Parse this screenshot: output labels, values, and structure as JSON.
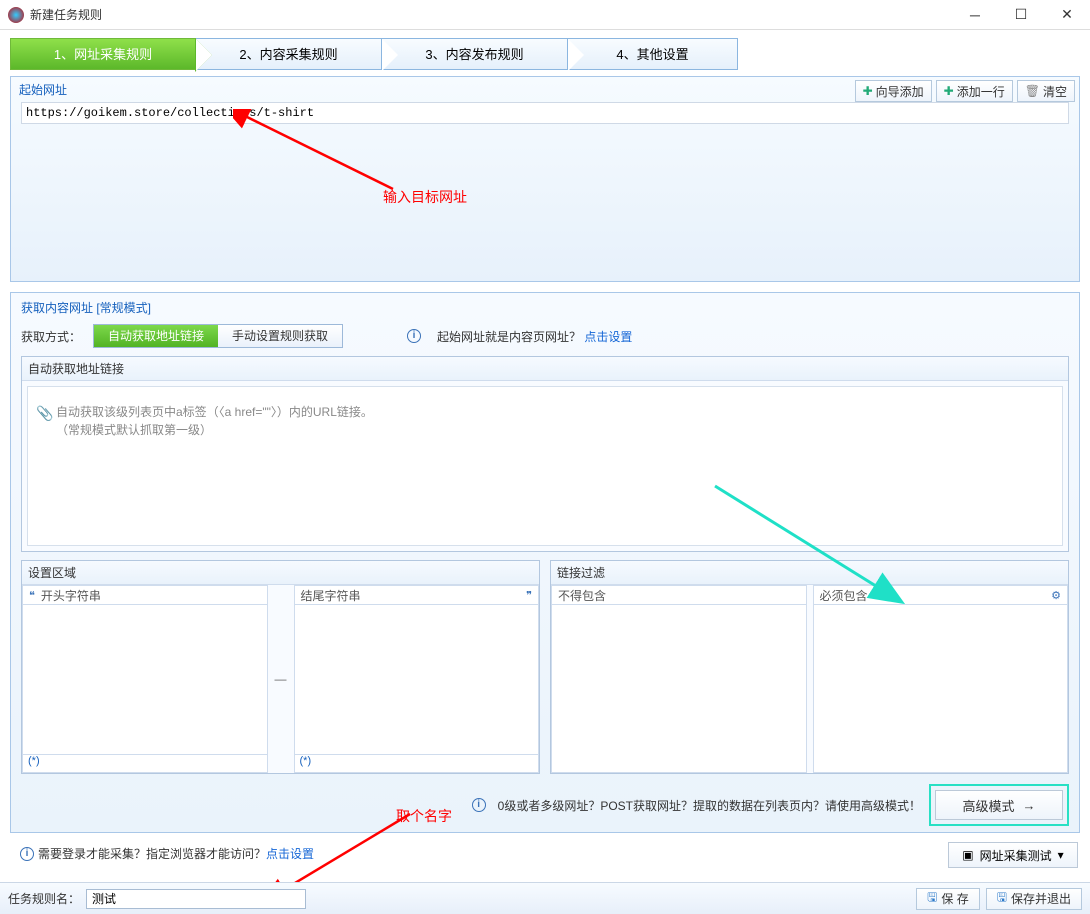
{
  "titlebar": {
    "title": "新建任务规则"
  },
  "steps": {
    "s1": "1、网址采集规则",
    "s2": "2、内容采集规则",
    "s3": "3、内容发布规则",
    "s4": "4、其他设置"
  },
  "start_url_section": {
    "title": "起始网址",
    "btn_wizard_add": "向导添加",
    "btn_add_row": "添加一行",
    "btn_clear": "清空",
    "url_value": "https://goikem.store/collections/t-shirt",
    "annotation": "输入目标网址"
  },
  "content_section": {
    "title": "获取内容网址 [常规模式]",
    "mode_label": "获取方式：",
    "mode_auto": "自动获取地址链接",
    "mode_manual": "手动设置规则获取",
    "hint_text": "起始网址就是内容页网址？",
    "hint_link": "点击设置",
    "auto_group_title": "自动获取地址链接",
    "auto_desc_line1": "自动获取该级列表页中a标签（〈a href=\"\"〉）内的URL链接。",
    "auto_desc_line2": "（常规模式默认抓取第一级）"
  },
  "area_section": {
    "title": "设置区域",
    "col1_head": "开头字符串",
    "col2_head": "结尾字符串",
    "star_mark": "(*)"
  },
  "filter_section": {
    "title": "链接过滤",
    "col1_head": "不得包含",
    "col2_head": "必须包含"
  },
  "advanced": {
    "hint": "0级或者多级网址？POST获取网址？提取的数据在列表页内？请使用高级模式！",
    "btn": "高级模式"
  },
  "annotation2": "取个名字",
  "login_hint": {
    "text": "需要登录才能采集？指定浏览器才能访问？",
    "link": "点击设置"
  },
  "test_btn": "网址采集测试",
  "footer": {
    "label": "任务规则名：",
    "value": "测试",
    "btn_save": "保 存",
    "btn_save_exit": "保存并退出"
  }
}
